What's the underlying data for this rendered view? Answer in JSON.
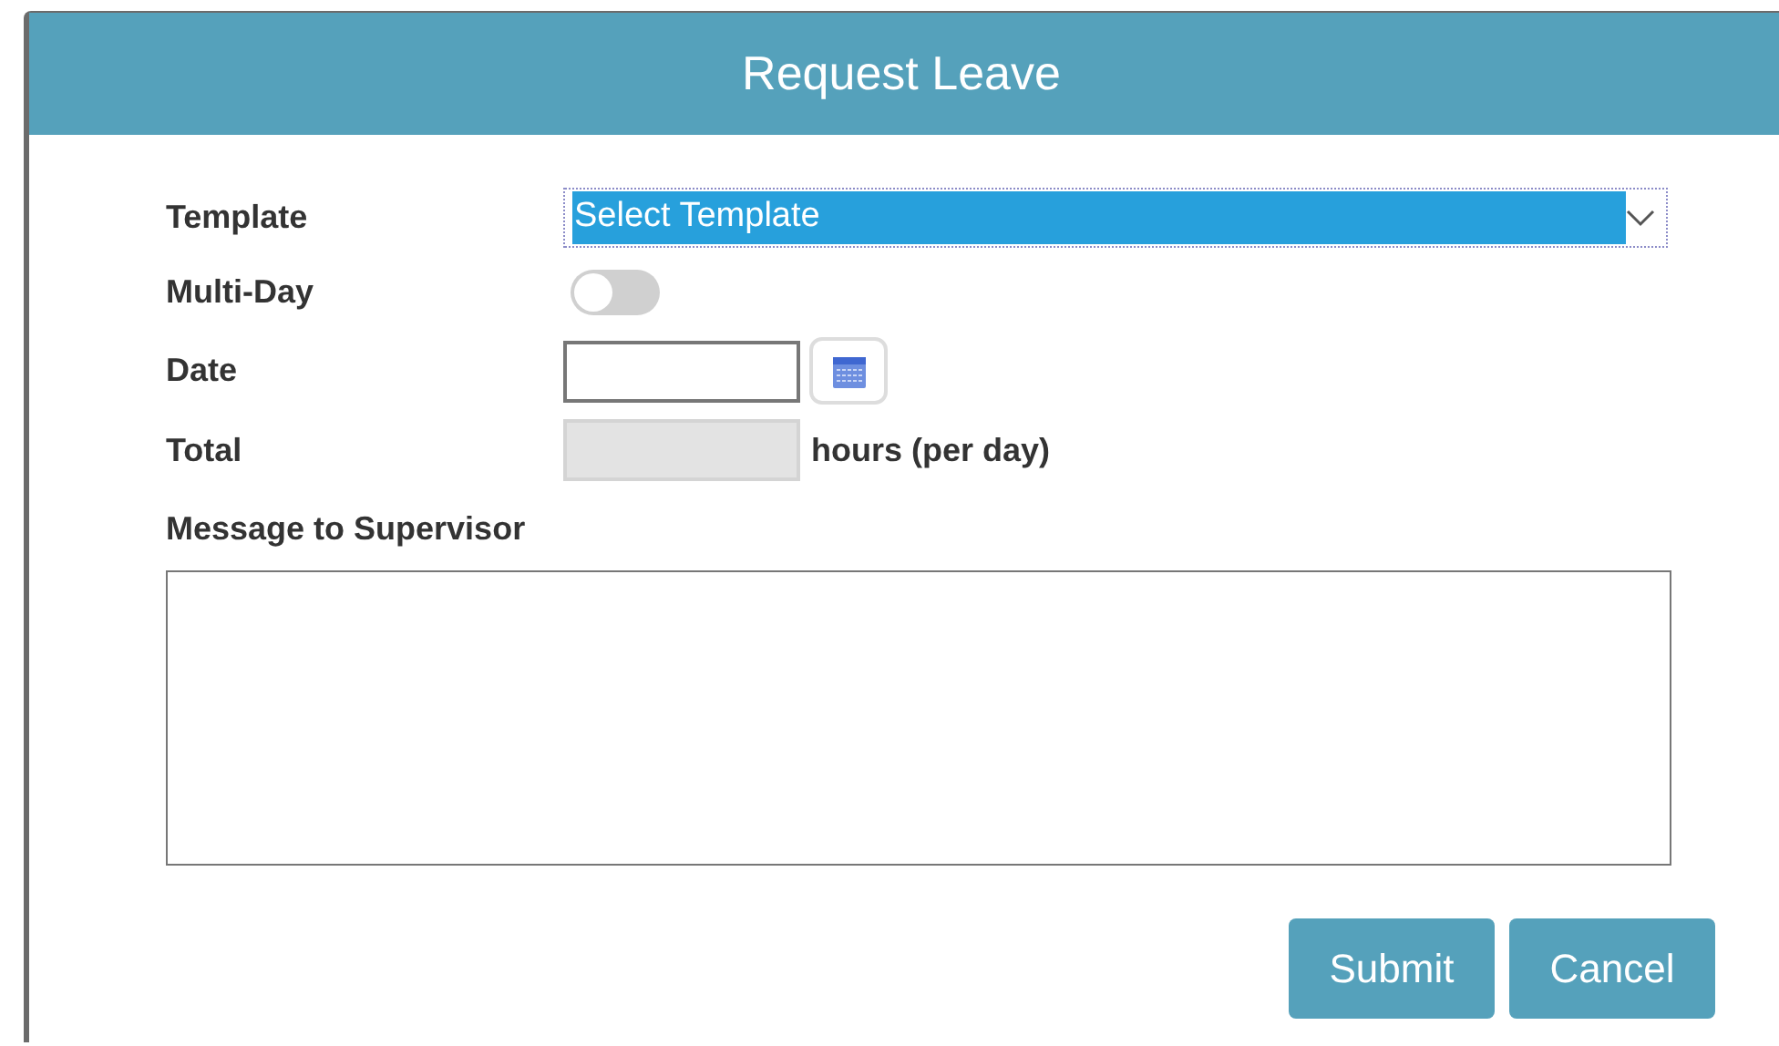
{
  "dialog": {
    "title": "Request Leave"
  },
  "template": {
    "label": "Template",
    "value": "Select Template",
    "selected": true
  },
  "multi_day": {
    "label": "Multi-Day",
    "on": false
  },
  "date": {
    "label": "Date"
  },
  "total": {
    "label": "Total",
    "unit": "hours (per day)",
    "disabled": true
  },
  "message": {
    "label": "Message to Supervisor"
  },
  "buttons": [
    {
      "label": "Submit"
    },
    {
      "label": "Cancel"
    }
  ]
}
